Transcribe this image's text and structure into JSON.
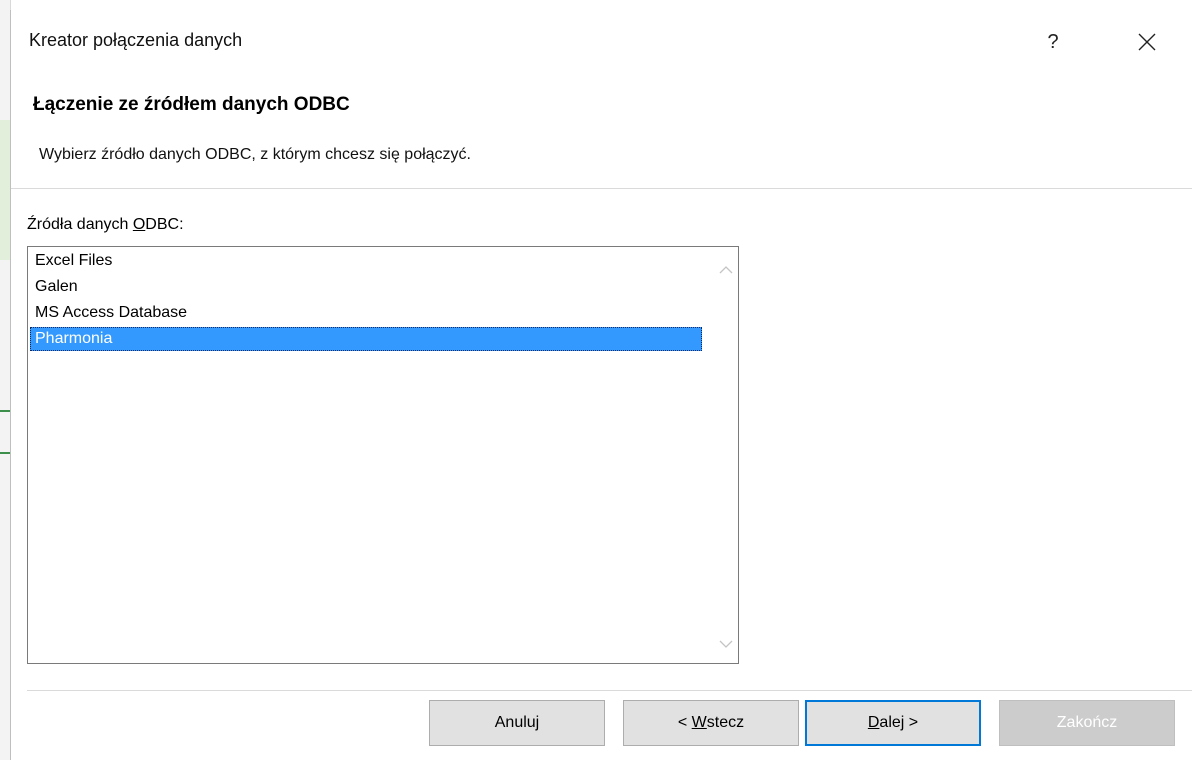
{
  "window": {
    "title": "Kreator połączenia danych",
    "help_label": "?"
  },
  "header": {
    "title": "Łączenie ze źródłem danych ODBC",
    "subtitle": "Wybierz źródło danych ODBC, z którym chcesz się połączyć."
  },
  "list": {
    "label_before": "Źródła danych ",
    "label_mnemonic": "O",
    "label_after": "DBC:",
    "items": [
      {
        "label": "Excel Files",
        "selected": false
      },
      {
        "label": "Galen",
        "selected": false
      },
      {
        "label": "MS Access Database",
        "selected": false
      },
      {
        "label": "Pharmonia",
        "selected": true
      }
    ]
  },
  "buttons": {
    "cancel": {
      "label": "Anuluj"
    },
    "back": {
      "prefix": "< ",
      "mnemonic": "W",
      "rest": "stecz"
    },
    "next": {
      "mnemonic": "D",
      "rest": "alej >"
    },
    "finish": {
      "label": "Zakończ",
      "disabled": true
    }
  },
  "colors": {
    "selection": "#3399ff",
    "default_button_border": "#0078d7"
  }
}
